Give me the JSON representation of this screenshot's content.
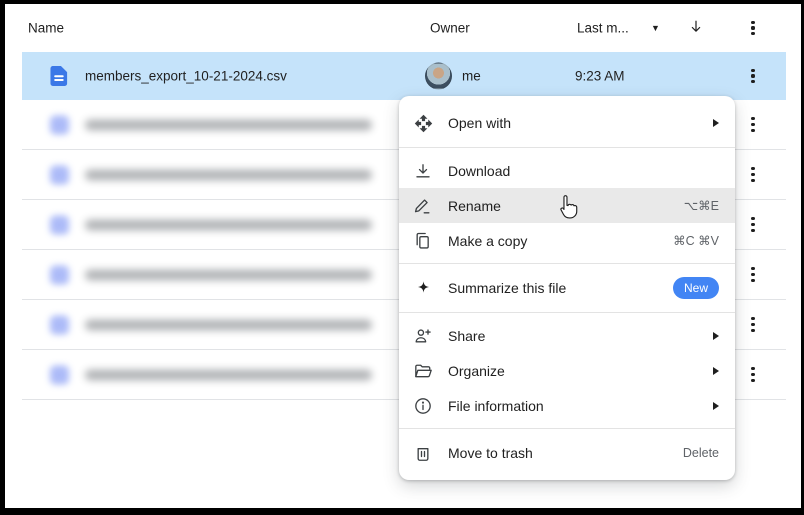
{
  "header": {
    "name": "Name",
    "owner": "Owner",
    "modified": "Last m...",
    "sort_icon": "arrow-down",
    "sort_caret": "dropdown-caret"
  },
  "selected_row": {
    "filename": "members_export_10-21-2024.csv",
    "owner": "me",
    "modified": "9:23 AM",
    "file_icon": "csv-file-icon"
  },
  "table": {
    "blurred_row_count": 6
  },
  "menu": {
    "sections": [
      {
        "items": [
          {
            "icon": "open-with-icon",
            "label": "Open with",
            "submenu": true
          }
        ]
      },
      {
        "items": [
          {
            "icon": "download-icon",
            "label": "Download"
          },
          {
            "icon": "rename-icon",
            "label": "Rename",
            "shortcut": "⌥⌘E",
            "highlighted": true
          },
          {
            "icon": "copy-icon",
            "label": "Make a copy",
            "shortcut": "⌘C ⌘V"
          }
        ]
      },
      {
        "items": [
          {
            "icon": "sparkle-icon",
            "label": "Summarize this file",
            "badge": "New"
          }
        ]
      },
      {
        "items": [
          {
            "icon": "person-add-icon",
            "label": "Share",
            "submenu": true
          },
          {
            "icon": "folder-icon",
            "label": "Organize",
            "submenu": true
          },
          {
            "icon": "info-icon",
            "label": "File information",
            "submenu": true
          }
        ]
      },
      {
        "items": [
          {
            "icon": "trash-icon",
            "label": "Move to trash",
            "shortcut": "Delete"
          }
        ]
      }
    ]
  },
  "colors": {
    "selection_blue": "#c5e3fa",
    "badge_blue": "#4285f4",
    "file_icon_blue": "#3b78e7"
  }
}
